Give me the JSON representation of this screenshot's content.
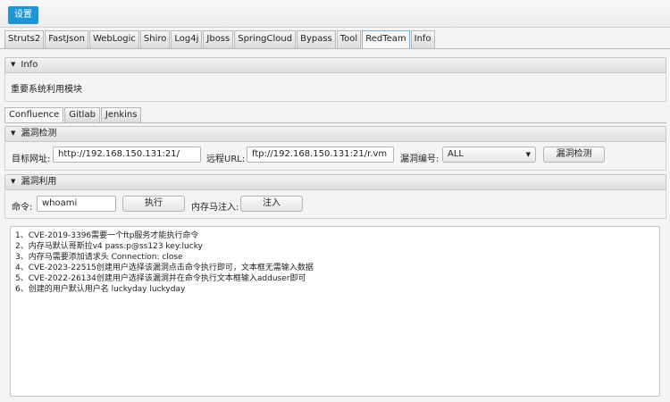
{
  "menubar": {
    "settings_label": "设置"
  },
  "main_tabs": [
    "Struts2",
    "FastJson",
    "WebLogic",
    "Shiro",
    "Log4j",
    "Jboss",
    "SpringCloud",
    "Bypass",
    "Tool",
    "RedTeam",
    "Info"
  ],
  "main_tabs_active": "RedTeam",
  "info_pane": {
    "title": "Info",
    "description": "重要系统利用模块"
  },
  "sub_tabs": [
    "Confluence",
    "Gitlab",
    "Jenkins"
  ],
  "sub_tabs_active": "Confluence",
  "detect_pane": {
    "title": "漏洞检测",
    "target_label": "目标网址:",
    "target_value": "http://192.168.150.131:21/",
    "remote_label": "远程URL:",
    "remote_value": "ftp://192.168.150.131:21/r.vm",
    "vuln_id_label": "漏洞编号:",
    "vuln_id_value": "ALL",
    "detect_button": "漏洞检测"
  },
  "exploit_pane": {
    "title": "漏洞利用",
    "command_label": "命令:",
    "command_value": "whoami",
    "execute_button": "执行",
    "memshell_label": "内存马注入:",
    "inject_button": "注入"
  },
  "output_lines": [
    "1、CVE-2019-3396需要一个ftp服务才能执行命令",
    "2、内存马默认哥斯拉v4 pass:p@ss123 key:lucky",
    "3、内存马需要添加请求头 Connection: close",
    "4、CVE-2023-22515创建用户选择该漏洞点击命令执行即可，文本框无需输入数据",
    "5、CVE-2022-26134创建用户选择该漏洞并在命令执行文本框输入adduser即可",
    "6、创建的用户默认用户名 luckyday luckyday"
  ]
}
